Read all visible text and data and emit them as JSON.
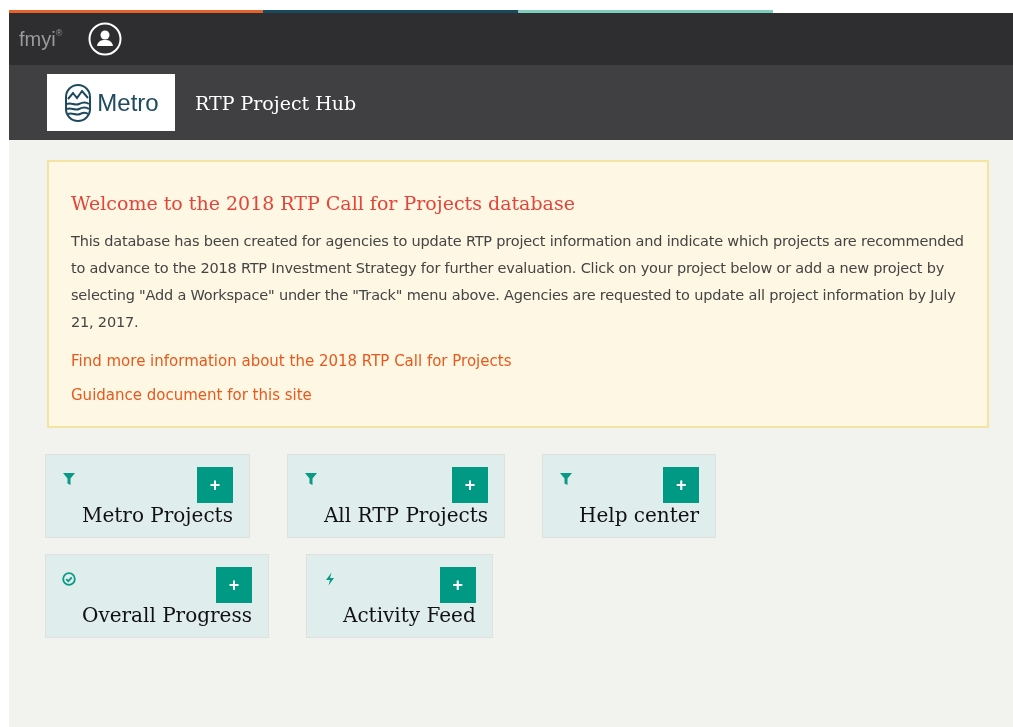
{
  "header": {
    "brand": "fmyi",
    "brand_mark": "®",
    "logo_text": "Metro",
    "title": "RTP Project Hub"
  },
  "welcome": {
    "heading": "Welcome to the 2018 RTP Call for Projects database",
    "body": "This database has been created for agencies to update RTP project information and indicate which projects are recommended to advance to the 2018 RTP Investment Strategy for further evaluation. Click on your project below or add a new project by selecting \"Add a Workspace\" under the \"Track\" menu above. Agencies are requested to update all project information by July 21, 2017.",
    "links": [
      "Find more information about the 2018 RTP Call for Projects",
      "Guidance document for this site"
    ]
  },
  "widget_rows": [
    [
      {
        "kind": "filter",
        "title": "Metro Projects",
        "action": "+"
      },
      {
        "kind": "filter",
        "title": "All RTP Projects",
        "action": "+"
      },
      {
        "kind": "filter",
        "title": "Help center",
        "action": "+"
      }
    ],
    [
      {
        "kind": "progress",
        "title": "Overall Progress",
        "action": "+"
      },
      {
        "kind": "feed",
        "title": "Activity Feed",
        "action": "+"
      }
    ]
  ]
}
